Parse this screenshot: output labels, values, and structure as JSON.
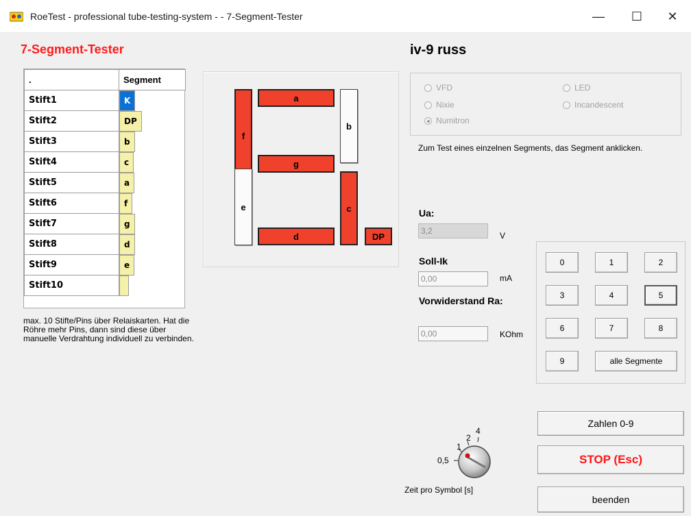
{
  "window": {
    "title": "RoeTest - professional tube-testing-system -  - 7-Segment-Tester",
    "minimize": "—",
    "maximize": "☐",
    "close": "✕"
  },
  "left": {
    "heading": "7-Segment-Tester",
    "grid": {
      "headers": [
        ".",
        "Segment"
      ],
      "rows": [
        {
          "pin": "Stift1",
          "segment": "K"
        },
        {
          "pin": "Stift2",
          "segment": "DP"
        },
        {
          "pin": "Stift3",
          "segment": "b"
        },
        {
          "pin": "Stift4",
          "segment": "c"
        },
        {
          "pin": "Stift5",
          "segment": "a"
        },
        {
          "pin": "Stift6",
          "segment": "f"
        },
        {
          "pin": "Stift7",
          "segment": "g"
        },
        {
          "pin": "Stift8",
          "segment": "d"
        },
        {
          "pin": "Stift9",
          "segment": "e"
        },
        {
          "pin": "Stift10",
          "segment": ""
        }
      ],
      "selected_row": 0
    },
    "note": "max. 10 Stifte/Pins über Relaiskarten. Hat die Röhre mehr Pins, dann sind diese über manuelle Verdrahtung individuell zu verbinden."
  },
  "display": {
    "segments": {
      "a": {
        "label": "a",
        "lit": true
      },
      "b": {
        "label": "b",
        "lit": false
      },
      "c": {
        "label": "c",
        "lit": true
      },
      "d": {
        "label": "d",
        "lit": true
      },
      "e": {
        "label": "e",
        "lit": false
      },
      "f": {
        "label": "f",
        "lit": true
      },
      "g": {
        "label": "g",
        "lit": true
      },
      "dp": {
        "label": "DP",
        "lit": true
      }
    },
    "colors": {
      "lit": "#f0412c",
      "unlit": "#fbfbfb"
    }
  },
  "right": {
    "tube_name": "iv-9 russ",
    "display_type": {
      "options": [
        "VFD",
        "LED",
        "Nixie",
        "Incandescent",
        "Numitron"
      ],
      "selected": "Numitron"
    },
    "instruction": "Zum Test eines einzelnen Segments, das Segment anklicken.",
    "ua": {
      "label": "Ua:",
      "value": "3,2",
      "unit": "V"
    },
    "soll_ik": {
      "label": "Soll-Ik",
      "value": "0,00",
      "unit": "mA"
    },
    "ra": {
      "label": "Vorwiderstand Ra:",
      "value": "0,00",
      "unit": "KOhm"
    },
    "digit_buttons": [
      "0",
      "1",
      "2",
      "3",
      "4",
      "5",
      "6",
      "7",
      "8",
      "9"
    ],
    "focused_digit": "5",
    "all_segments_button": "alle Segmente",
    "numbers_button": "Zahlen 0-9",
    "stop_button": "STOP (Esc)",
    "exit_button": "beenden",
    "time_knob": {
      "labels": [
        "0,5",
        "1",
        "2",
        "4"
      ],
      "selected": "0,5",
      "caption": "Zeit pro Symbol [s]"
    }
  }
}
